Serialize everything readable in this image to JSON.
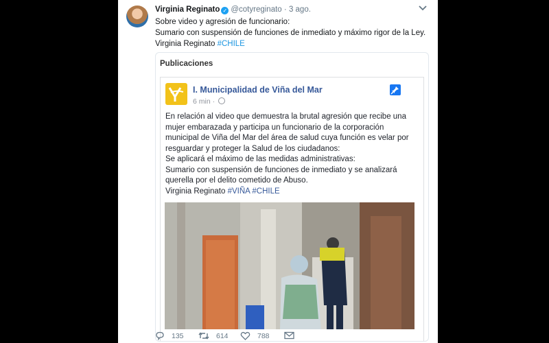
{
  "tweet": {
    "author_name": "Virginia Reginato",
    "author_handle": "@cotyreginato",
    "separator": "·",
    "date": "3 ago.",
    "text_lines": [
      "Sobre video y agresión de funcionario:",
      "Sumario con suspensión de funciones de inmediato  y máximo rigor de la Ley.",
      "Virginia Reginato "
    ],
    "hashtag": "#CHILE"
  },
  "card": {
    "title": "Publicaciones",
    "post": {
      "page_name": "I. Municipalidad de Viña del Mar",
      "time": "6 min",
      "time_separator": "·",
      "lines": [
        "En relación al video que demuestra la brutal agresión que recibe una",
        "mujer embarazada y participa un funcionario de la corporación",
        "municipal de Viña del Mar del área de salud cuya función es velar por",
        "resguardar y proteger la Salud de los ciudadanos:",
        "Se aplicará el máximo de las medidas administrativas:",
        "Sumario con suspensión de funciones de inmediato y se analizará",
        "querella por el delito cometido de Abuso."
      ],
      "signature": "Virginia Reginato ",
      "hashtags": "#VIÑA #CHILE"
    }
  },
  "actions": {
    "replies": "135",
    "retweets": "614",
    "likes": "788"
  },
  "icons": {
    "verified": "verified-badge-icon",
    "chevron": "chevron-down-icon",
    "pin": "pin-icon",
    "globe": "globe-icon",
    "reply": "reply-icon",
    "retweet": "retweet-icon",
    "like": "heart-icon",
    "dm": "envelope-icon"
  },
  "colors": {
    "link": "#1b95e0",
    "fb_link": "#365899",
    "verified": "#1da1f2",
    "muted": "#657786"
  }
}
